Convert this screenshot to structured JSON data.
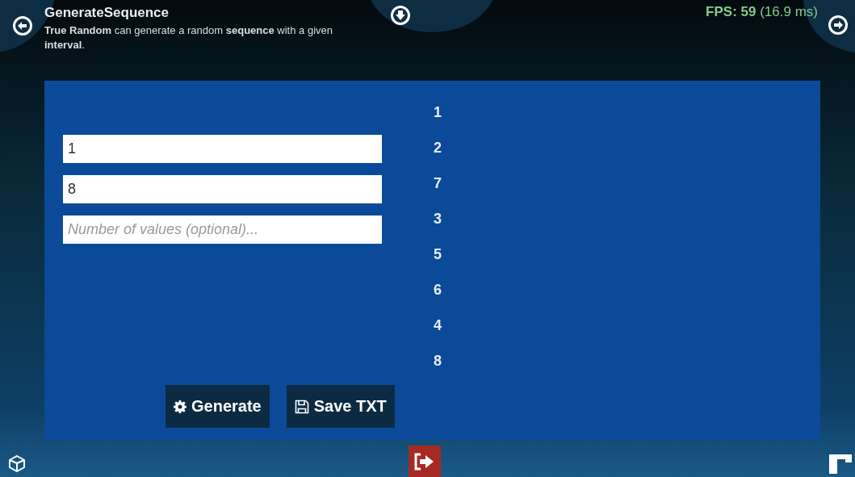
{
  "title": "GenerateSequence",
  "description": "**True Random** can generate a random **sequence** with a given **interval**.",
  "fps": {
    "label": "FPS: 59",
    "detail": "(16.9 ms)"
  },
  "fields": [
    {
      "value": "1"
    },
    {
      "value": "8"
    },
    {
      "placeholder": "Number of values (optional)..."
    }
  ],
  "results": [
    "1",
    "2",
    "7",
    "3",
    "5",
    "6",
    "4",
    "8"
  ],
  "buttons": [
    {
      "label": "Generate",
      "kind": "generate"
    },
    {
      "label": "Save TXT",
      "kind": "save"
    }
  ]
}
